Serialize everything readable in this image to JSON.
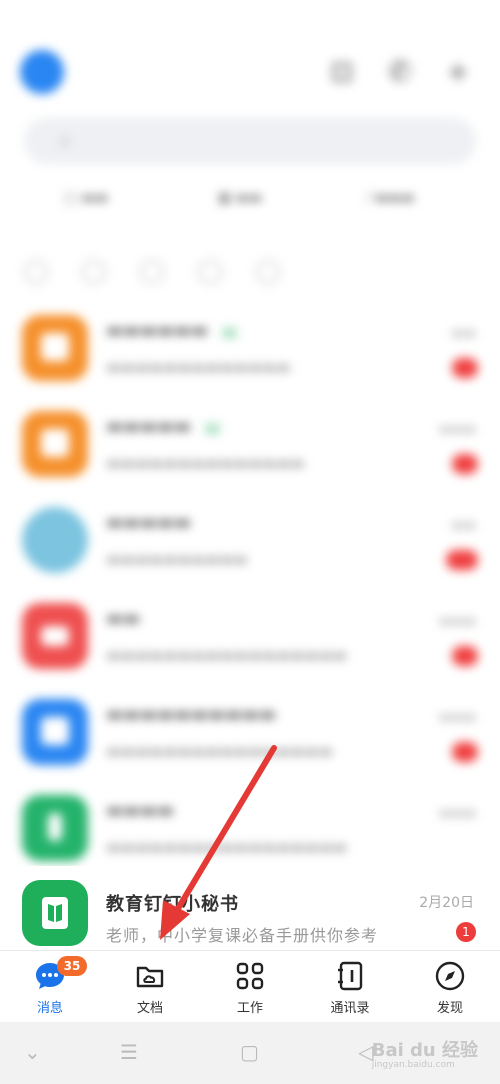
{
  "colors": {
    "accent": "#1a73e8",
    "badge": "#ee3b3b",
    "tab_badge": "#f36b2a",
    "arrow": "#e53935",
    "last_chat_avatar": "#1fae5a"
  },
  "last_chat": {
    "name": "教育钉钉小秘书",
    "date": "2月20日",
    "preview": "老师，中小学复课必备手册供你参考",
    "unread": "1",
    "avatar_icon": "open-book-icon"
  },
  "tabbar": {
    "tabs": [
      {
        "label": "消息",
        "icon": "chat-bubble-icon",
        "badge": "35",
        "active": true
      },
      {
        "label": "文档",
        "icon": "cloud-folder-icon",
        "active": false
      },
      {
        "label": "工作",
        "icon": "grid-apps-icon",
        "active": false
      },
      {
        "label": "通讯录",
        "icon": "contacts-book-icon",
        "active": false
      },
      {
        "label": "发现",
        "icon": "compass-icon",
        "active": false
      }
    ]
  },
  "watermark": {
    "text": "Bai du 经验",
    "sub": "jingyan.baidu.com"
  }
}
